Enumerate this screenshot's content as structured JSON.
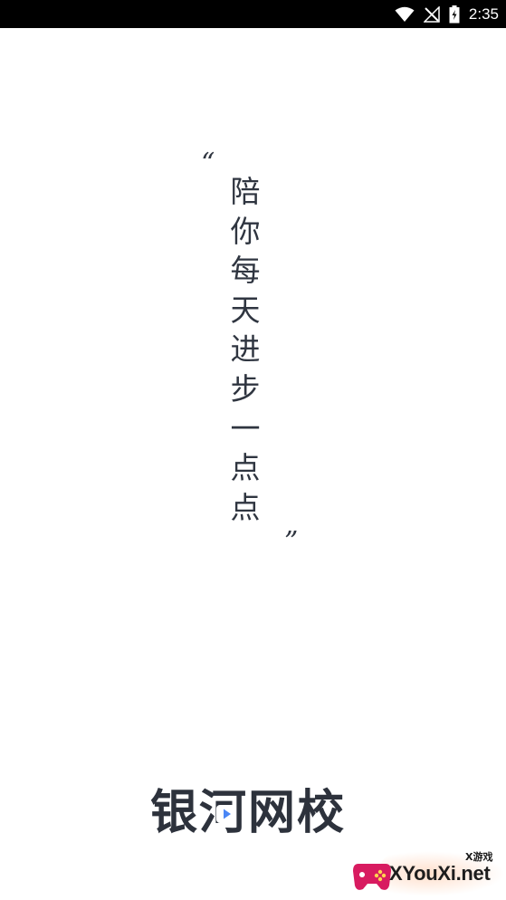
{
  "status_bar": {
    "time": "2:35",
    "icons": [
      "wifi-icon",
      "signal-off-icon",
      "battery-charging-icon"
    ]
  },
  "quote": {
    "open_mark": "“",
    "close_mark": "”",
    "chars": [
      "陪",
      "你",
      "每",
      "天",
      "进",
      "步",
      "一",
      "点",
      "点"
    ]
  },
  "brand": {
    "logo_text": "银河网校",
    "accent_color": "#4a86f5",
    "text_color": "#2d323c"
  },
  "watermark": {
    "small_text": "X游戏",
    "domain": "XYouXi.net"
  }
}
